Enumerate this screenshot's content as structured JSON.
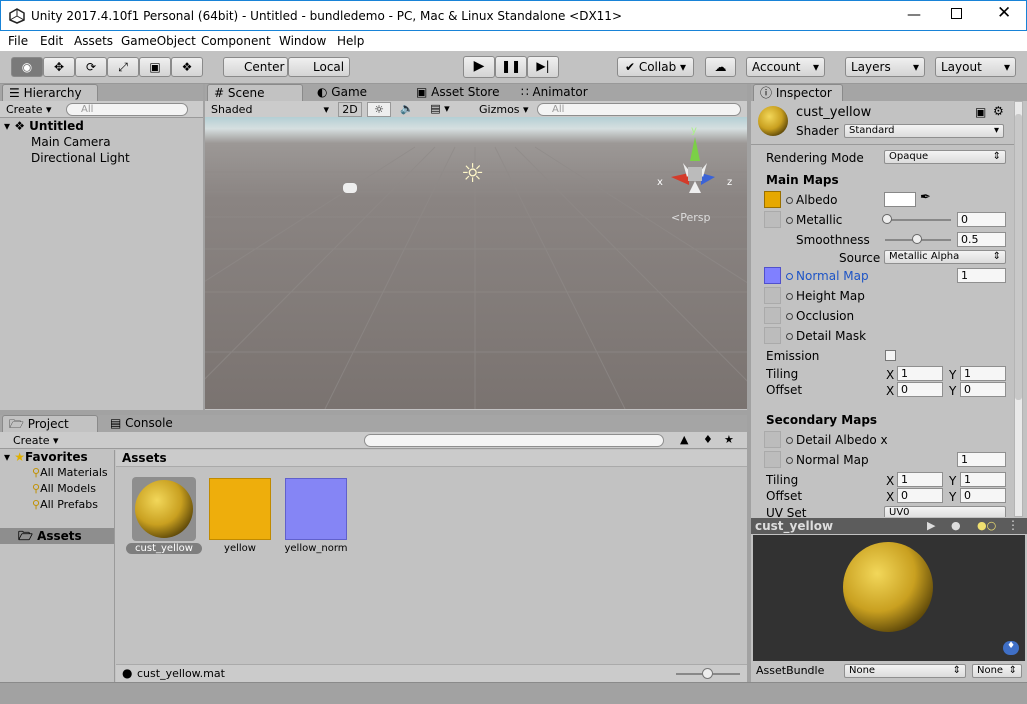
{
  "window": {
    "title": "Unity 2017.4.10f1 Personal (64bit) - Untitled - bundledemo - PC, Mac & Linux Standalone <DX11>"
  },
  "menu": [
    "File",
    "Edit",
    "Assets",
    "GameObject",
    "Component",
    "Window",
    "Help"
  ],
  "toolbar": {
    "center": "Center",
    "local": "Local",
    "collab": "Collab",
    "account": "Account",
    "layers": "Layers",
    "layout": "Layout"
  },
  "hierarchy": {
    "tab": "Hierarchy",
    "create": "Create",
    "search_placeholder": "All",
    "scene": "Untitled",
    "items": [
      "Main Camera",
      "Directional Light"
    ]
  },
  "scene": {
    "tabs": [
      "Scene",
      "Game",
      "Asset Store",
      "Animator"
    ],
    "shading": "Shaded",
    "mode_2d": "2D",
    "gizmos": "Gizmos",
    "search_placeholder": "All",
    "persp": "Persp",
    "axis_x": "x",
    "axis_y": "y",
    "axis_z": "z"
  },
  "project": {
    "tabs": [
      "Project",
      "Console"
    ],
    "create": "Create",
    "favorites": "Favorites",
    "favorite_items": [
      "All Materials",
      "All Models",
      "All Prefabs"
    ],
    "assets_folder": "Assets",
    "breadcrumb": "Assets",
    "assets": [
      {
        "name": "cust_yellow",
        "selected": true
      },
      {
        "name": "yellow"
      },
      {
        "name": "yellow_norm"
      }
    ],
    "footer_file": "cust_yellow.mat"
  },
  "inspector": {
    "tab": "Inspector",
    "material_name": "cust_yellow",
    "shader_label": "Shader",
    "shader": "Standard",
    "rendering_mode_label": "Rendering Mode",
    "rendering_mode": "Opaque",
    "main_maps": "Main Maps",
    "albedo": "Albedo",
    "metallic": "Metallic",
    "metallic_value": "0",
    "smoothness": "Smoothness",
    "smoothness_value": "0.5",
    "source_label": "Source",
    "source": "Metallic Alpha",
    "normal_map": "Normal Map",
    "normal_value": "1",
    "height_map": "Height Map",
    "occlusion": "Occlusion",
    "detail_mask": "Detail Mask",
    "emission": "Emission",
    "tiling": "Tiling",
    "offset": "Offset",
    "x": "X",
    "y": "Y",
    "tiling_x": "1",
    "tiling_y": "1",
    "offset_x": "0",
    "offset_y": "0",
    "secondary_maps": "Secondary Maps",
    "detail_albedo": "Detail Albedo x",
    "normal_map2": "Normal Map",
    "normal_value2": "1",
    "tiling2_x": "1",
    "tiling2_y": "1",
    "offset2_x": "0",
    "offset2_y": "0",
    "uv_set_label": "UV Set",
    "uv_set": "UV0",
    "preview_title": "cust_yellow",
    "assetbundle_label": "AssetBundle",
    "bundle_none": "None",
    "variant_none": "None"
  },
  "colors": {
    "albedo": "#e6a800",
    "normal": "#8080ff",
    "highlight_text": "#1d54c6"
  }
}
